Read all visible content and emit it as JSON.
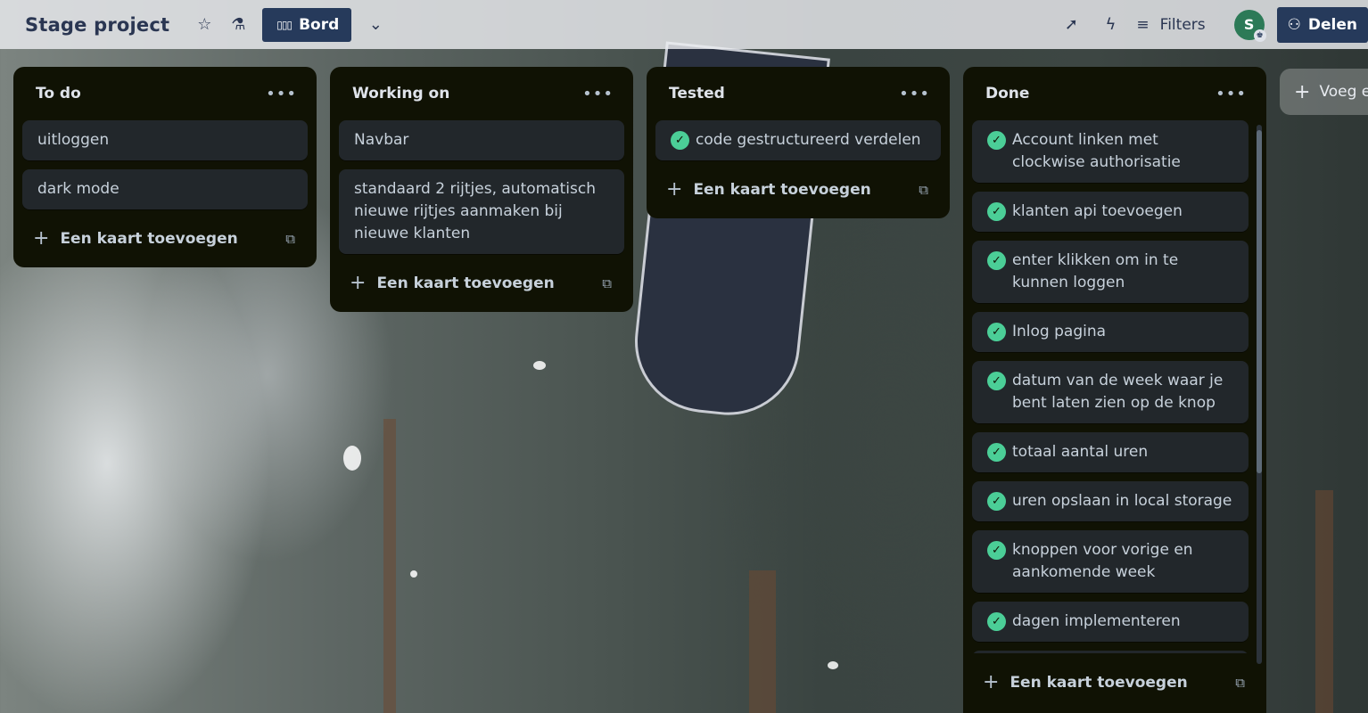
{
  "header": {
    "board_title": "Stage project",
    "view_label": "Bord",
    "filters_label": "Filters",
    "avatar_initial": "S",
    "share_label": "Delen"
  },
  "lists": [
    {
      "title": "To do",
      "cards": [
        {
          "text": "uitloggen",
          "done": false
        },
        {
          "text": "dark mode",
          "done": false
        }
      ],
      "add_label": "Een kaart toevoegen"
    },
    {
      "title": "Working on",
      "cards": [
        {
          "text": "Navbar",
          "done": false
        },
        {
          "text": "standaard 2 rijtjes, automatisch nieuwe rijtjes aanmaken bij nieuwe klanten",
          "done": false
        }
      ],
      "add_label": "Een kaart toevoegen"
    },
    {
      "title": "Tested",
      "cards": [
        {
          "text": "code gestructureerd verdelen",
          "done": true
        }
      ],
      "add_label": "Een kaart toevoegen"
    },
    {
      "title": "Done",
      "cards": [
        {
          "text": "Account linken met clockwise authorisatie",
          "done": true
        },
        {
          "text": "klanten api toevoegen",
          "done": true
        },
        {
          "text": "enter klikken om in te kunnen loggen",
          "done": true
        },
        {
          "text": "Inlog pagina",
          "done": true
        },
        {
          "text": "datum van de week waar je bent laten zien op de knop",
          "done": true
        },
        {
          "text": "totaal aantal uren",
          "done": true
        },
        {
          "text": "uren opslaan in local storage",
          "done": true
        },
        {
          "text": "knoppen voor vorige en aankomende week",
          "done": true
        },
        {
          "text": "dagen implementeren",
          "done": true
        },
        {
          "text": "",
          "done": false
        }
      ],
      "add_label": "Een kaart toevoegen"
    }
  ],
  "add_list_label": "Voeg e",
  "colors": {
    "header_accent": "#263a5b",
    "list_bg": "#101204",
    "card_bg": "#22272b",
    "check_green": "#4bce97"
  }
}
